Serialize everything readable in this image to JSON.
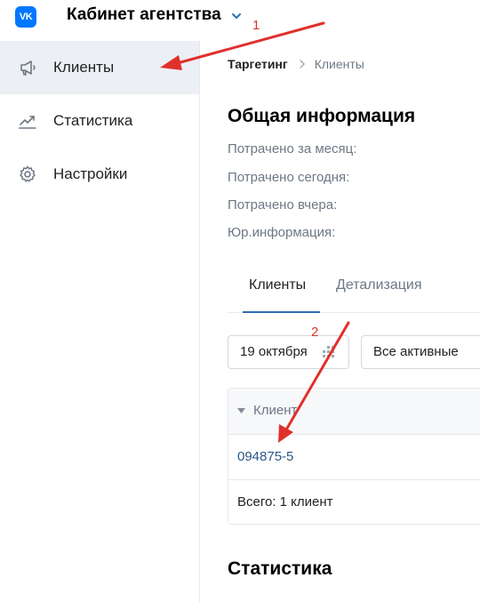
{
  "header": {
    "logo_text": "VK",
    "title": "Кабинет агентства"
  },
  "sidebar": {
    "items": [
      {
        "label": "Клиенты",
        "icon": "megaphone-icon",
        "active": true
      },
      {
        "label": "Статистика",
        "icon": "chart-icon",
        "active": false
      },
      {
        "label": "Настройки",
        "icon": "gear-icon",
        "active": false
      }
    ]
  },
  "breadcrumb": {
    "root": "Таргетинг",
    "current": "Клиенты"
  },
  "general_info": {
    "title": "Общая информация",
    "rows": [
      "Потрачено за месяц:",
      "Потрачено сегодня:",
      "Потрачено вчера:",
      "Юр.информация:"
    ]
  },
  "tabs": [
    {
      "label": "Клиенты",
      "active": true
    },
    {
      "label": "Детализация",
      "active": false
    }
  ],
  "controls": {
    "date": "19 октября",
    "status": "Все активные"
  },
  "table": {
    "column_header": "Клиент",
    "rows": [
      {
        "client": "094875-5"
      }
    ],
    "total": "Всего: 1 клиент"
  },
  "statistics": {
    "title": "Статистика"
  },
  "annotations": {
    "marker_1": "1",
    "marker_2": "2",
    "color": "#e0302c"
  },
  "colors": {
    "accent": "#2d6fb5",
    "link": "#2a5885",
    "brand": "#0077ff",
    "sidebar_active_bg": "#eceff3"
  }
}
